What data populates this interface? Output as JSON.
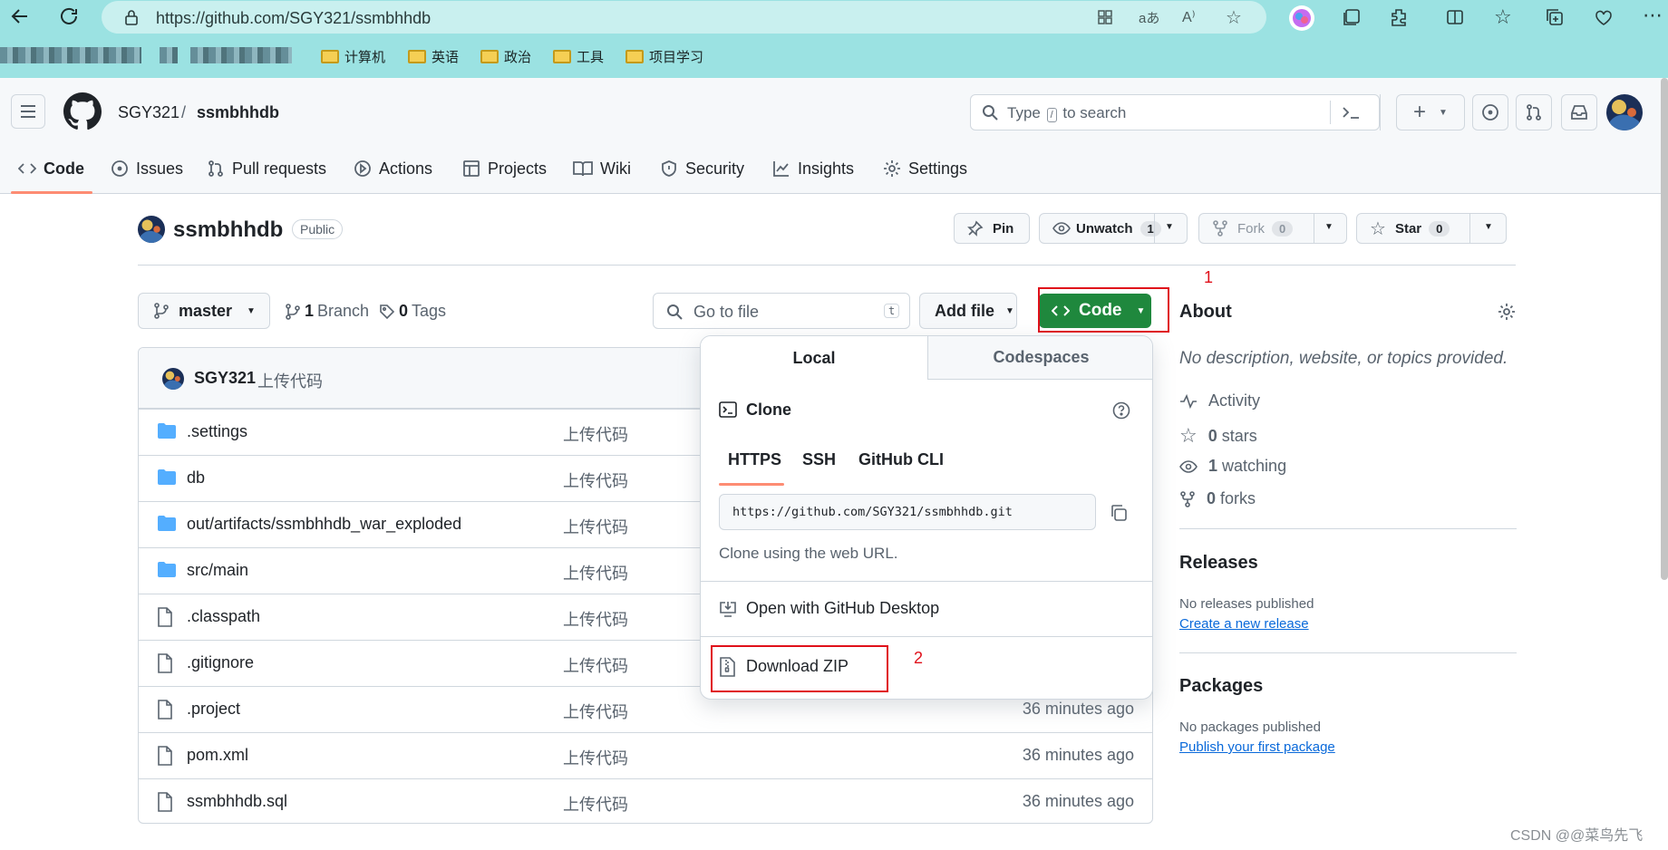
{
  "browser": {
    "url": "https://github.com/SGY321/ssmbhhdb",
    "bookmarks": [
      "计算机",
      "英语",
      "政治",
      "工具",
      "项目学习"
    ]
  },
  "header": {
    "owner": "SGY321",
    "slash": "/",
    "repo": "ssmbhhdb",
    "search_pre": "Type",
    "search_key": "/",
    "search_post": "to search",
    "plus": "+"
  },
  "nav": {
    "tabs": [
      {
        "label": "Code",
        "icon": "code-icon",
        "selected": true
      },
      {
        "label": "Issues",
        "icon": "issue-opened-icon"
      },
      {
        "label": "Pull requests",
        "icon": "git-pull-request-icon"
      },
      {
        "label": "Actions",
        "icon": "play-icon"
      },
      {
        "label": "Projects",
        "icon": "table-icon"
      },
      {
        "label": "Wiki",
        "icon": "book-icon"
      },
      {
        "label": "Security",
        "icon": "shield-icon"
      },
      {
        "label": "Insights",
        "icon": "graph-icon"
      },
      {
        "label": "Settings",
        "icon": "gear-icon"
      }
    ]
  },
  "repo": {
    "name": "ssmbhhdb",
    "visibility": "Public",
    "pin_label": "Pin",
    "unwatch_label": "Unwatch",
    "watch_count": "1",
    "fork_label": "Fork",
    "fork_count": "0",
    "star_label": "Star",
    "star_count": "0"
  },
  "toolbar": {
    "branch": "master",
    "branch_count": "1",
    "branch_label": "Branch",
    "tags_count": "0",
    "tags_label": "Tags",
    "go_to_file": "Go to file",
    "go_key": "t",
    "add_file": "Add file",
    "code": "Code"
  },
  "commit": {
    "author": "SGY321",
    "message": "上传代码"
  },
  "files": [
    {
      "name": ".settings",
      "type": "dir",
      "message": "上传代码",
      "time": ""
    },
    {
      "name": "db",
      "type": "dir",
      "message": "上传代码",
      "time": ""
    },
    {
      "name": "out/artifacts/ssmbhhdb_war_exploded",
      "type": "dir",
      "message": "上传代码",
      "time": ""
    },
    {
      "name": "src/main",
      "type": "dir",
      "message": "上传代码",
      "time": ""
    },
    {
      "name": ".classpath",
      "type": "file",
      "message": "上传代码",
      "time": ""
    },
    {
      "name": ".gitignore",
      "type": "file",
      "message": "上传代码",
      "time": ""
    },
    {
      "name": ".project",
      "type": "file",
      "message": "上传代码",
      "time": "36 minutes ago"
    },
    {
      "name": "pom.xml",
      "type": "file",
      "message": "上传代码",
      "time": "36 minutes ago"
    },
    {
      "name": "ssmbhhdb.sql",
      "type": "file",
      "message": "上传代码",
      "time": "36 minutes ago"
    }
  ],
  "dropdown": {
    "tab_local": "Local",
    "tab_codespaces": "Codespaces",
    "clone_title": "Clone",
    "protocols": [
      "HTTPS",
      "SSH",
      "GitHub CLI"
    ],
    "clone_url": "https://github.com/SGY321/ssmbhhdb.git",
    "clone_hint": "Clone using the web URL.",
    "open_desktop": "Open with GitHub Desktop",
    "download_zip": "Download ZIP"
  },
  "about": {
    "title": "About",
    "description": "No description, website, or topics provided.",
    "activity": "Activity",
    "stars_count": "0",
    "stars_label": "stars",
    "watching_count": "1",
    "watching_label": "watching",
    "forks_count": "0",
    "forks_label": "forks"
  },
  "releases": {
    "title": "Releases",
    "empty": "No releases published",
    "link": "Create a new release"
  },
  "packages": {
    "title": "Packages",
    "empty": "No packages published",
    "link": "Publish your first package"
  },
  "annotations": {
    "one": "1",
    "two": "2"
  },
  "watermark": "CSDN @@菜鸟先飞",
  "colors": {
    "primary": "#1f883d",
    "link": "#0969da",
    "annotation": "#e0101a"
  }
}
